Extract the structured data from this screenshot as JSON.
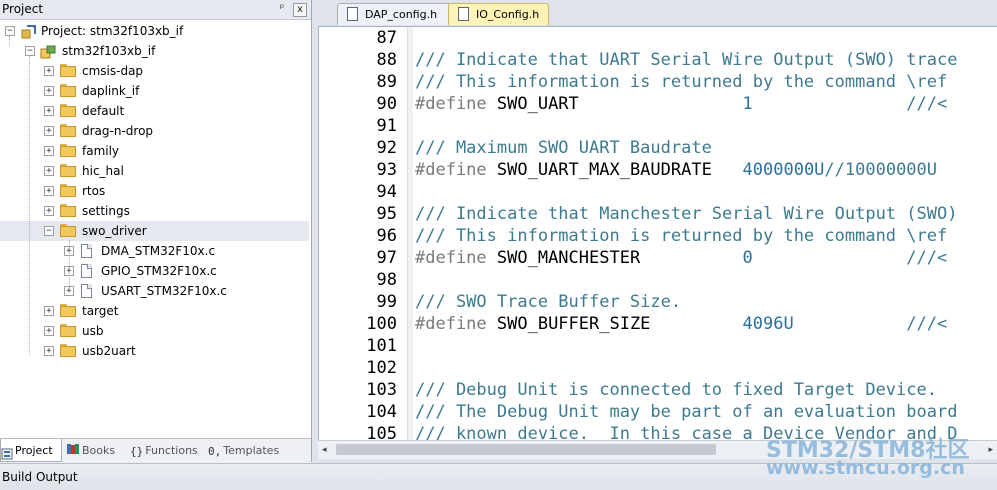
{
  "project": {
    "header_title": "Project",
    "pin_glyph": "ᵖ",
    "close_glyph": "x",
    "root_label": "Project: stm32f103xb_if",
    "target_label": "stm32f103xb_if",
    "folders": [
      {
        "label": "cmsis-dap",
        "expander": "+"
      },
      {
        "label": "daplink_if",
        "expander": "+"
      },
      {
        "label": "default",
        "expander": "+"
      },
      {
        "label": "drag-n-drop",
        "expander": "+"
      },
      {
        "label": "family",
        "expander": "+"
      },
      {
        "label": "hic_hal",
        "expander": "+"
      },
      {
        "label": "rtos",
        "expander": "+"
      },
      {
        "label": "settings",
        "expander": "+"
      },
      {
        "label": "swo_driver",
        "expander": "−"
      },
      {
        "label": "target",
        "expander": "+"
      },
      {
        "label": "usb",
        "expander": "+"
      },
      {
        "label": "usb2uart",
        "expander": "+"
      }
    ],
    "swo_files": [
      {
        "label": "DMA_STM32F10x.c",
        "expander": "+"
      },
      {
        "label": "GPIO_STM32F10x.c",
        "expander": "+"
      },
      {
        "label": "USART_STM32F10x.c",
        "expander": "+"
      }
    ],
    "tabs": [
      {
        "label": "Project",
        "icon": "project-tab-icon"
      },
      {
        "label": "Books",
        "icon": "books-icon"
      },
      {
        "label": "Functions",
        "icon": "functions-icon"
      },
      {
        "label": "Templates",
        "icon": "templates-icon"
      }
    ]
  },
  "editor": {
    "tabs": [
      {
        "label": "DAP_config.h",
        "active": false
      },
      {
        "label": "IO_Config.h",
        "active": true
      }
    ],
    "lines": [
      {
        "n": "87",
        "segs": []
      },
      {
        "n": "88",
        "segs": [
          {
            "t": "cmt",
            "s": "/// Indicate that UART Serial Wire Output (SWO) trace"
          }
        ]
      },
      {
        "n": "89",
        "segs": [
          {
            "t": "cmt",
            "s": "/// This information is returned by the command \\ref"
          }
        ]
      },
      {
        "n": "90",
        "segs": [
          {
            "t": "pp",
            "s": "#define"
          },
          {
            "t": "id",
            "s": " SWO_UART                "
          },
          {
            "t": "num",
            "s": "1"
          },
          {
            "t": "cmt",
            "s": "               ///<"
          }
        ]
      },
      {
        "n": "91",
        "segs": []
      },
      {
        "n": "92",
        "segs": [
          {
            "t": "cmt",
            "s": "/// Maximum SWO UART Baudrate"
          }
        ]
      },
      {
        "n": "93",
        "segs": [
          {
            "t": "pp",
            "s": "#define"
          },
          {
            "t": "id",
            "s": " SWO_UART_MAX_BAUDRATE   "
          },
          {
            "t": "num",
            "s": "4000000U"
          },
          {
            "t": "cmt",
            "s": "//10000000U"
          }
        ]
      },
      {
        "n": "94",
        "segs": []
      },
      {
        "n": "95",
        "segs": [
          {
            "t": "cmt",
            "s": "/// Indicate that Manchester Serial Wire Output (SWO)"
          }
        ]
      },
      {
        "n": "96",
        "segs": [
          {
            "t": "cmt",
            "s": "/// This information is returned by the command \\ref"
          }
        ]
      },
      {
        "n": "97",
        "segs": [
          {
            "t": "pp",
            "s": "#define"
          },
          {
            "t": "id",
            "s": " SWO_MANCHESTER          "
          },
          {
            "t": "num",
            "s": "0"
          },
          {
            "t": "cmt",
            "s": "               ///<"
          }
        ]
      },
      {
        "n": "98",
        "segs": []
      },
      {
        "n": "99",
        "segs": [
          {
            "t": "cmt",
            "s": "/// SWO Trace Buffer Size."
          }
        ]
      },
      {
        "n": "100",
        "segs": [
          {
            "t": "pp",
            "s": "#define"
          },
          {
            "t": "id",
            "s": " SWO_BUFFER_SIZE         "
          },
          {
            "t": "num",
            "s": "4096U"
          },
          {
            "t": "cmt",
            "s": "           ///<"
          }
        ]
      },
      {
        "n": "101",
        "segs": []
      },
      {
        "n": "102",
        "segs": []
      },
      {
        "n": "103",
        "segs": [
          {
            "t": "cmt",
            "s": "/// Debug Unit is connected to fixed Target Device."
          }
        ]
      },
      {
        "n": "104",
        "segs": [
          {
            "t": "cmt",
            "s": "/// The Debug Unit may be part of an evaluation board"
          }
        ]
      },
      {
        "n": "105",
        "segs": [
          {
            "t": "cmt",
            "s": "/// known device.  In this case a Device Vendor and D"
          }
        ]
      }
    ],
    "scroll_left_glyph": "◂",
    "scroll_right_glyph": "▸"
  },
  "build_output": {
    "title": "Build Output"
  },
  "watermark": {
    "line1": "STM32/STM8社区",
    "line2": "www.stmcu.org.cn"
  },
  "colors": {
    "comment": "#3e7a8f",
    "preprocessor": "#7a7a7a",
    "number": "#2a6f9e",
    "active_tab": "#fff3b8",
    "folder": "#f1c85c"
  }
}
